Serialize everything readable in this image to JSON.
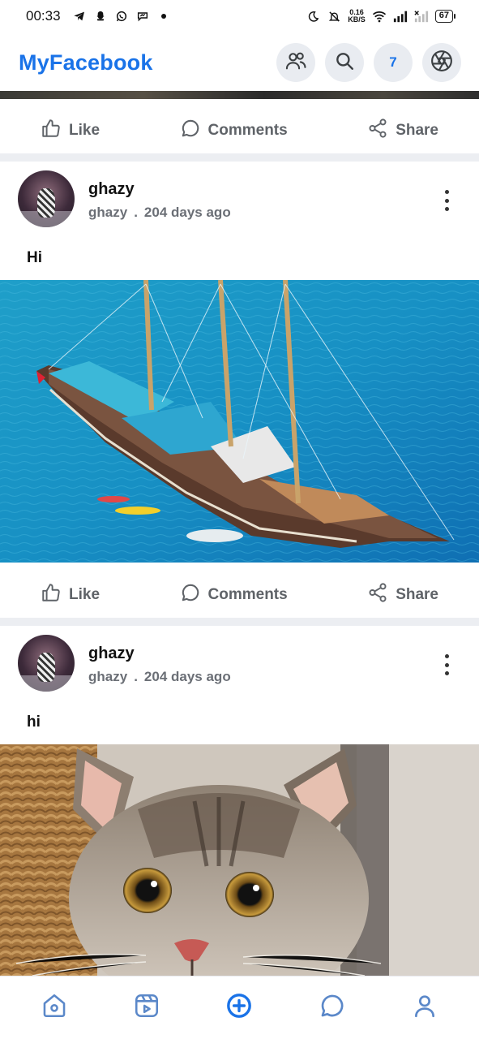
{
  "status_bar": {
    "time": "00:33",
    "speed_value": "0.16",
    "speed_unit": "KB/S",
    "battery": "67"
  },
  "header": {
    "brand": "MyFacebook",
    "notification_count": "7"
  },
  "actions": {
    "like": "Like",
    "comments": "Comments",
    "share": "Share"
  },
  "posts": [
    {
      "author": "ghazy",
      "username": "ghazy",
      "separator": ".",
      "time_ago": "204 days ago",
      "text": "Hi",
      "image": "sailing-ship-photo"
    },
    {
      "author": "ghazy",
      "username": "ghazy",
      "separator": ".",
      "time_ago": "204 days ago",
      "text": "hi",
      "image": "kitten-photo"
    }
  ],
  "colors": {
    "accent": "#1a73e8",
    "icon_grey": "#5f6368",
    "nav_icon": "#5b88c9"
  }
}
